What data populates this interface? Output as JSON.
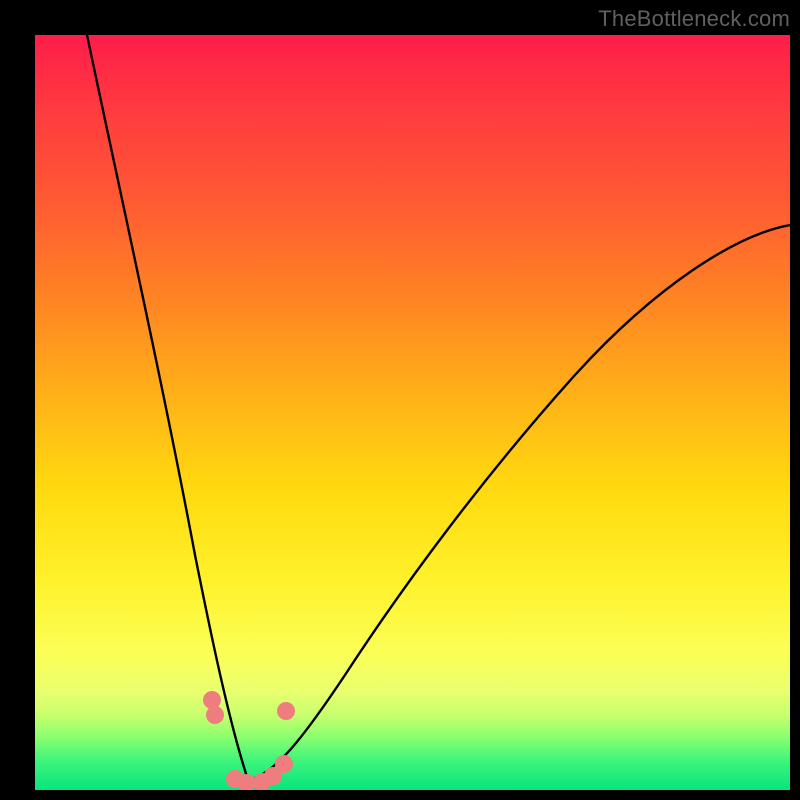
{
  "watermark": "TheBottleneck.com",
  "chart_data": {
    "type": "line",
    "title": "",
    "xlabel": "",
    "ylabel": "",
    "xlim": [
      0,
      100
    ],
    "ylim": [
      0,
      100
    ],
    "notes": "V-shaped bottleneck curve over a vertical red-to-green heat gradient. No axis ticks or numeric labels are shown. Curve minimum sits near the green band at roughly x≈28. Pink dot markers cluster around the trough.",
    "series": [
      {
        "name": "curve-left",
        "x": [
          7,
          10,
          13,
          16,
          18,
          20,
          22,
          24,
          26,
          28
        ],
        "y": [
          100,
          80,
          62,
          47,
          36,
          27,
          19,
          12,
          5,
          1
        ]
      },
      {
        "name": "curve-right",
        "x": [
          28,
          32,
          36,
          42,
          50,
          58,
          66,
          76,
          88,
          100
        ],
        "y": [
          1,
          3,
          8,
          15,
          24,
          33,
          42,
          52,
          63,
          73
        ]
      }
    ],
    "markers": {
      "name": "trough-dots",
      "color": "#ef7d80",
      "x": [
        23.5,
        23.8,
        26.5,
        28.0,
        30.0,
        31.5,
        33.0,
        33.2
      ],
      "y": [
        11.5,
        10.0,
        1.2,
        0.8,
        0.9,
        1.5,
        3.0,
        9.5
      ]
    }
  }
}
